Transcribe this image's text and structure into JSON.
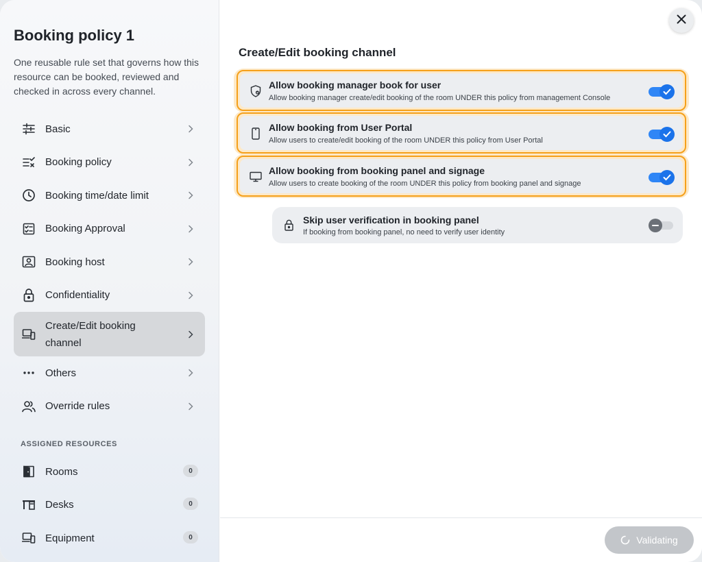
{
  "sidebar": {
    "title": "Booking policy 1",
    "description": "One reusable rule set that governs how this resource can be booked, reviewed and checked in across every channel.",
    "items": [
      {
        "label": "Basic",
        "icon": "sliders-icon"
      },
      {
        "label": "Booking policy",
        "icon": "list-check-icon"
      },
      {
        "label": "Booking time/date limit",
        "icon": "clock-icon"
      },
      {
        "label": "Booking Approval",
        "icon": "approval-icon"
      },
      {
        "label": "Booking host",
        "icon": "host-icon"
      },
      {
        "label": "Confidentiality",
        "icon": "lock-icon"
      },
      {
        "label": "Create/Edit booking channel",
        "icon": "devices-icon",
        "active": true
      },
      {
        "label": "Others",
        "icon": "more-icon"
      },
      {
        "label": "Override rules",
        "icon": "users-icon"
      }
    ],
    "assigned_label": "ASSIGNED RESOURCES",
    "resources": [
      {
        "label": "Rooms",
        "count": "0",
        "icon": "door-icon"
      },
      {
        "label": "Desks",
        "count": "0",
        "icon": "desk-icon"
      },
      {
        "label": "Equipment",
        "count": "0",
        "icon": "equipment-icon"
      }
    ]
  },
  "main": {
    "title": "Create/Edit booking channel",
    "options": [
      {
        "title": "Allow booking manager book for user",
        "subtitle": "Allow booking manager create/edit booking of the room UNDER this policy from management Console",
        "enabled": true,
        "icon": "shield-icon"
      },
      {
        "title": "Allow booking from User Portal",
        "subtitle": "Allow users to create/edit booking of the room UNDER this policy from User Portal",
        "enabled": true,
        "icon": "phone-icon"
      },
      {
        "title": "Allow booking from booking panel and signage",
        "subtitle": "Allow users to create booking of the room UNDER this policy from booking panel and signage",
        "enabled": true,
        "icon": "monitor-icon"
      }
    ],
    "sub_option": {
      "title": "Skip user verification in booking panel",
      "subtitle": "If booking from booking panel, no need to verify user identity",
      "enabled": false,
      "icon": "lock-icon"
    }
  },
  "footer": {
    "validate_label": "Validating"
  },
  "colors": {
    "accent": "#1b73ea",
    "highlight": "#f5a01a"
  }
}
